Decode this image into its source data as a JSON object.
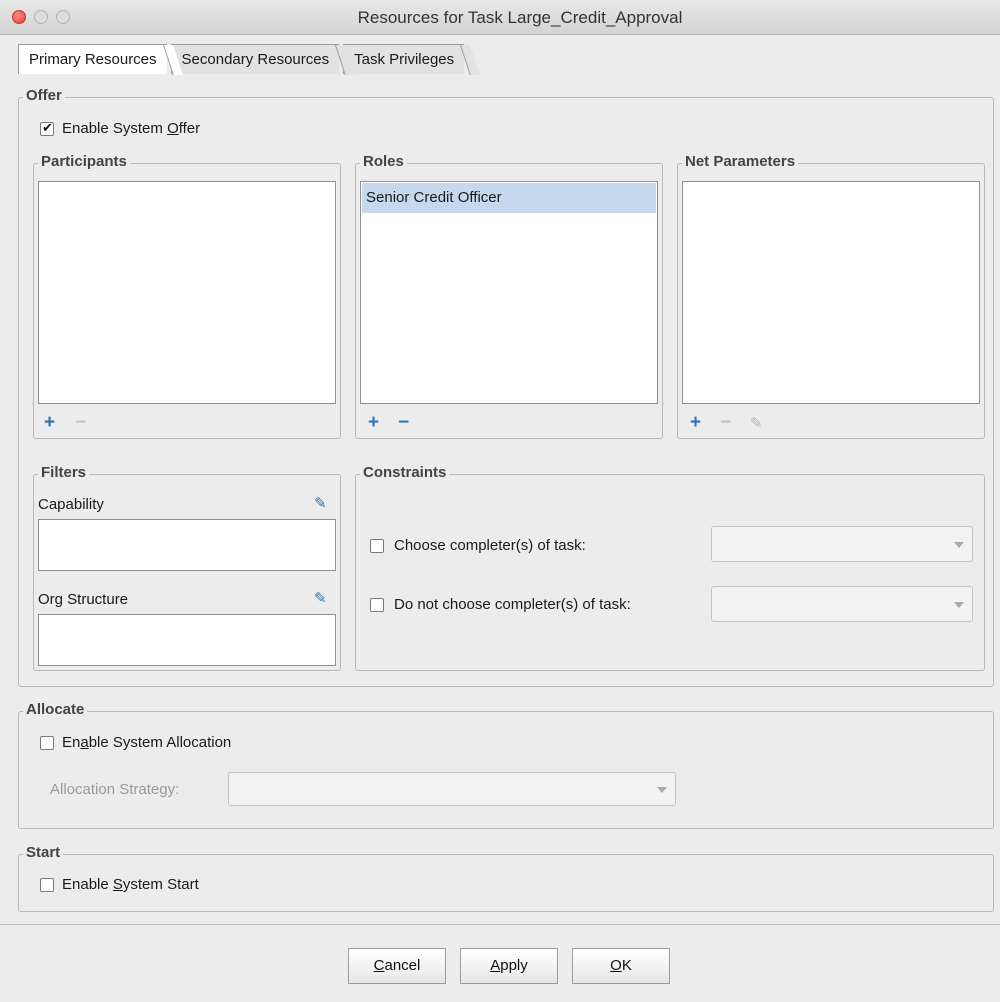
{
  "window": {
    "title": "Resources for Task Large_Credit_Approval"
  },
  "tabs": [
    {
      "label": "Primary Resources",
      "active": true
    },
    {
      "label": "Secondary Resources",
      "active": false
    },
    {
      "label": "Task Privileges",
      "active": false
    }
  ],
  "offer": {
    "label": "Offer",
    "enable_system_offer": {
      "label_pre": "Enable System ",
      "label_mnemonic": "O",
      "label_post": "ffer",
      "checked": true
    },
    "participants": {
      "label": "Participants",
      "items": [],
      "add": "+",
      "remove": "−"
    },
    "roles": {
      "label": "Roles",
      "items": [
        "Senior Credit Officer"
      ],
      "add": "+",
      "remove": "−"
    },
    "net_parameters": {
      "label": "Net Parameters",
      "items": [],
      "add": "+",
      "remove": "−",
      "edit_icon": "pencil-icon"
    },
    "filters": {
      "label": "Filters",
      "capability": {
        "label": "Capability",
        "value": ""
      },
      "org_structure": {
        "label": "Org Structure",
        "value": ""
      }
    },
    "constraints": {
      "label": "Constraints",
      "choose_completers": {
        "label": "Choose completer(s) of task:",
        "checked": false,
        "value": ""
      },
      "do_not_choose_completers": {
        "label": "Do not choose completer(s) of task:",
        "checked": false,
        "value": ""
      }
    }
  },
  "allocate": {
    "label": "Allocate",
    "enable_system_allocation": {
      "label_pre": "En",
      "label_mnemonic": "a",
      "label_post": "ble System Allocation",
      "checked": false
    },
    "allocation_strategy": {
      "label": "Allocation Strategy:",
      "value": ""
    }
  },
  "start": {
    "label": "Start",
    "enable_system_start": {
      "label_pre": "Enable ",
      "label_mnemonic": "S",
      "label_post": "ystem Start",
      "checked": false
    }
  },
  "buttons": {
    "cancel": {
      "mnemonic": "C",
      "rest": "ancel"
    },
    "apply": {
      "mnemonic": "A",
      "rest": "pply"
    },
    "ok": {
      "mnemonic": "O",
      "rest": "K"
    }
  },
  "colors": {
    "accent": "#2f72b8",
    "selection": "#c5d8ee",
    "close_button": "#e0443a"
  }
}
